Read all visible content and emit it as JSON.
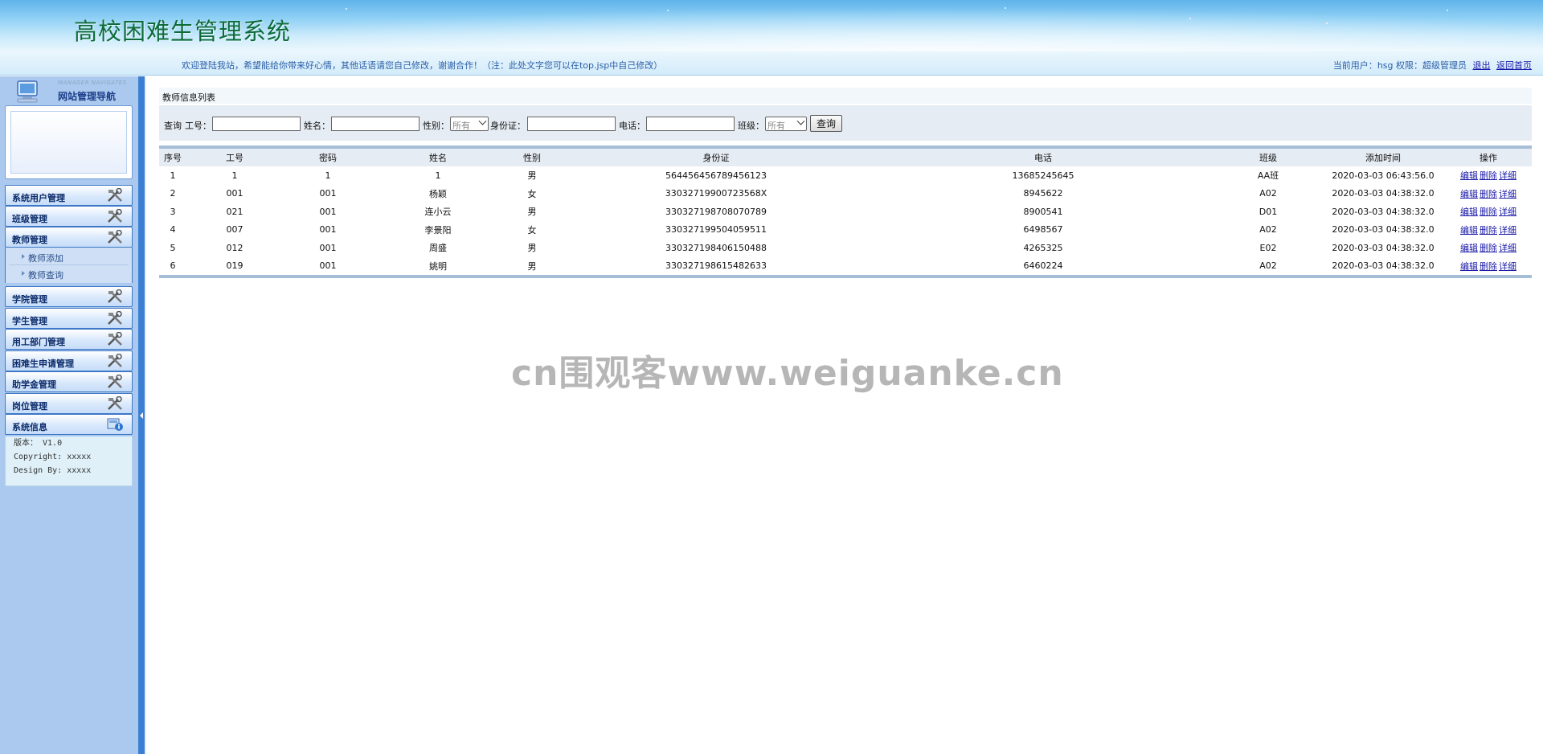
{
  "header": {
    "title": "高校困难生管理系统"
  },
  "infobar": {
    "welcome": "欢迎登陆我站，希望能给你带来好心情，其他话语请您自己修改，谢谢合作！（注：此处文字您可以在top.jsp中自己修改）",
    "user_prefix": "当前用户：",
    "user_name": "hsg",
    "role_prefix": " 权限：",
    "role": "超级管理员",
    "logout": "退出",
    "home": "返回首页"
  },
  "sidebar": {
    "nav_title_en": "MANAGER NAVIGATES",
    "nav_title": "网站管理导航",
    "menus": [
      {
        "label": "系统用户管理"
      },
      {
        "label": "班级管理"
      },
      {
        "label": "教师管理"
      },
      {
        "label": "学院管理"
      },
      {
        "label": "学生管理"
      },
      {
        "label": "用工部门管理"
      },
      {
        "label": "困难生申请管理"
      },
      {
        "label": "助学金管理"
      },
      {
        "label": "岗位管理"
      },
      {
        "label": "系统信息"
      }
    ],
    "teacher_sub": [
      {
        "label": "教师添加"
      },
      {
        "label": "教师查询"
      }
    ],
    "sysinfo": {
      "version": "版本： V1.0",
      "copyright": "Copyright: xxxxx",
      "design": "Design By:  xxxxx"
    }
  },
  "main": {
    "panel_title": "教师信息列表",
    "search": {
      "query_label": "查询",
      "id_label": "工号：",
      "name_label": "姓名：",
      "gender_label": "性别：",
      "gender_value": "所有",
      "idcard_label": "身份证：",
      "phone_label": "电话：",
      "class_label": "班级：",
      "class_value": "所有",
      "button": "查询"
    },
    "table": {
      "columns": [
        "序号",
        "工号",
        "密码",
        "姓名",
        "性别",
        "身份证",
        "电话",
        "班级",
        "添加时间",
        "操作"
      ],
      "actions": [
        "编辑",
        "删除",
        "详细"
      ],
      "rows": [
        [
          "1",
          "1",
          "1",
          "1",
          "男",
          "564456456789456123",
          "13685245645",
          "AA班",
          "2020-03-03 06:43:56.0"
        ],
        [
          "2",
          "001",
          "001",
          "杨颖",
          "女",
          "33032719900723568X",
          "8945622",
          "A02",
          "2020-03-03 04:38:32.0"
        ],
        [
          "3",
          "021",
          "001",
          "连小云",
          "男",
          "330327198708070789",
          "8900541",
          "D01",
          "2020-03-03 04:38:32.0"
        ],
        [
          "4",
          "007",
          "001",
          "李景阳",
          "女",
          "330327199504059511",
          "6498567",
          "A02",
          "2020-03-03 04:38:32.0"
        ],
        [
          "5",
          "012",
          "001",
          "周盛",
          "男",
          "330327198406150488",
          "4265325",
          "E02",
          "2020-03-03 04:38:32.0"
        ],
        [
          "6",
          "019",
          "001",
          "姚明",
          "男",
          "330327198615482633",
          "6460224",
          "A02",
          "2020-03-03 04:38:32.0"
        ]
      ]
    }
  },
  "watermark": "cn围观客www.weiguanke.cn"
}
